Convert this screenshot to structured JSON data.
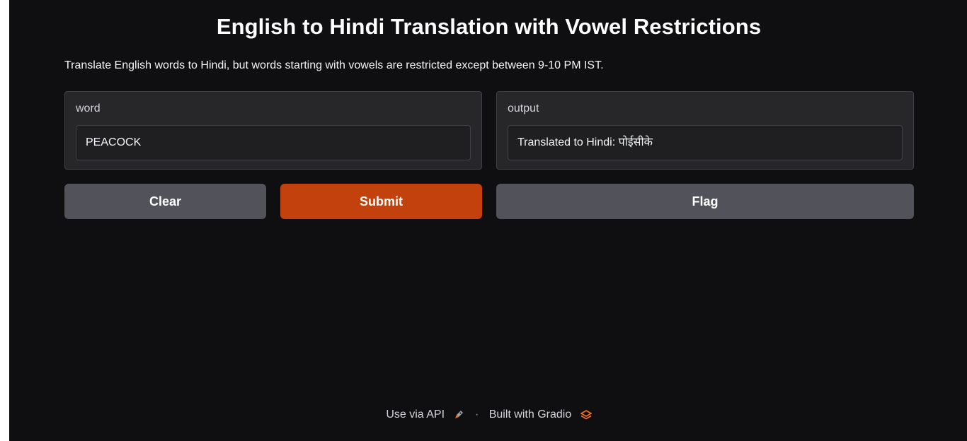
{
  "app": {
    "title": "English to Hindi Translation with Vowel Restrictions",
    "description": "Translate English words to Hindi, but words starting with vowels are restricted except between 9-10 PM IST."
  },
  "input": {
    "label": "word",
    "value": "PEACOCK"
  },
  "output": {
    "label": "output",
    "value": "Translated to Hindi: पोईसीके"
  },
  "buttons": {
    "clear": "Clear",
    "submit": "Submit",
    "flag": "Flag"
  },
  "footer": {
    "api_link": "Use via API",
    "api_icon": "rocket-icon",
    "separator": "·",
    "built_with": "Built with Gradio",
    "gradio_icon": "gradio-logo-icon"
  },
  "colors": {
    "background": "#0f0f11",
    "panel": "#27272a",
    "submit_accent": "#c2410c",
    "secondary_button": "#52525b",
    "gradio_orange": "#f97316"
  }
}
